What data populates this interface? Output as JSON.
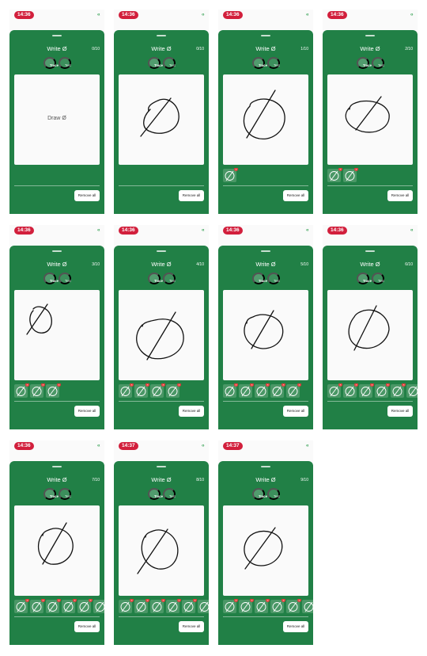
{
  "screens": [
    {
      "time": "14:36",
      "title": "Write Ø",
      "counter": "0/10",
      "trace": "Trace",
      "test": "Test",
      "hint": "Draw Ø",
      "remove": "Remove all",
      "thumbs": []
    },
    {
      "time": "14:36",
      "title": "Write Ø",
      "counter": "0/10",
      "trace": "Trace",
      "test": "Test",
      "hint": "",
      "remove": "Remove all",
      "thumbs": []
    },
    {
      "time": "14:36",
      "title": "Write Ø",
      "counter": "1/10",
      "trace": "Trace",
      "test": "Test",
      "hint": "",
      "remove": "Remove all",
      "thumbs": [
        {
          "badge": "×"
        }
      ]
    },
    {
      "time": "14:36",
      "title": "Write Ø",
      "counter": "2/10",
      "trace": "Trace",
      "test": "Test",
      "hint": "",
      "remove": "Remove all",
      "thumbs": [
        {
          "badge": "×"
        },
        {
          "badge": "×"
        }
      ]
    },
    {
      "time": "14:36",
      "title": "Write Ø",
      "counter": "3/10",
      "trace": "Trace",
      "test": "Test",
      "hint": "",
      "remove": "Remove all",
      "thumbs": [
        {
          "badge": "×"
        },
        {
          "badge": "×"
        },
        {
          "badge": "×"
        }
      ]
    },
    {
      "time": "14:36",
      "title": "Write Ø",
      "counter": "4/10",
      "trace": "Trace",
      "test": "Test",
      "hint": "",
      "remove": "Remove all",
      "thumbs": [
        {
          "badge": "×"
        },
        {
          "badge": "×"
        },
        {
          "badge": "×"
        },
        {
          "badge": "×"
        }
      ]
    },
    {
      "time": "14:36",
      "title": "Write Ø",
      "counter": "5/10",
      "trace": "Trace",
      "test": "Test",
      "hint": "",
      "remove": "Remove all",
      "thumbs": [
        {
          "badge": "×"
        },
        {
          "badge": "×"
        },
        {
          "badge": "×"
        },
        {
          "badge": "×"
        },
        {
          "badge": "×"
        }
      ]
    },
    {
      "time": "14:36",
      "title": "Write Ø",
      "counter": "6/10",
      "trace": "Trace",
      "test": "Test",
      "hint": "",
      "remove": "Remove all",
      "thumbs": [
        {
          "badge": "×"
        },
        {
          "badge": "×"
        },
        {
          "badge": "×"
        },
        {
          "badge": "×"
        },
        {
          "badge": "×"
        },
        {
          "badge": "×"
        }
      ]
    },
    {
      "time": "14:36",
      "title": "Write Ø",
      "counter": "7/10",
      "trace": "Trace",
      "test": "Test",
      "hint": "",
      "remove": "Remove all",
      "thumbs": [
        {
          "badge": "×"
        },
        {
          "badge": "×"
        },
        {
          "badge": "×"
        },
        {
          "badge": "×"
        },
        {
          "badge": "×"
        },
        {
          "badge": "×"
        },
        {
          "badge": "×"
        }
      ]
    },
    {
      "time": "14:37",
      "title": "Write Ø",
      "counter": "8/10",
      "trace": "Trace",
      "test": "Test",
      "hint": "",
      "remove": "Remove all",
      "thumbs": [
        {
          "badge": "×"
        },
        {
          "badge": "×"
        },
        {
          "badge": "×"
        },
        {
          "badge": "×"
        },
        {
          "badge": "×"
        },
        {
          "badge": "×"
        },
        {
          "badge": "×"
        }
      ]
    },
    {
      "time": "14:37",
      "title": "Write Ø",
      "counter": "9/10",
      "trace": "Trace",
      "test": "Test",
      "hint": "",
      "remove": "Remove all",
      "thumbs": [
        {
          "badge": "×"
        },
        {
          "badge": "×"
        },
        {
          "badge": "×"
        },
        {
          "badge": "×"
        },
        {
          "badge": "×"
        },
        {
          "badge": "×"
        },
        {
          "badge": "×"
        }
      ]
    }
  ],
  "colors": {
    "sheet": "#218046",
    "badge": "#e53838",
    "time_pill": "#d21f3c"
  },
  "icons": {
    "signal": "signal-icon",
    "thumb": "slashed-o-icon"
  }
}
